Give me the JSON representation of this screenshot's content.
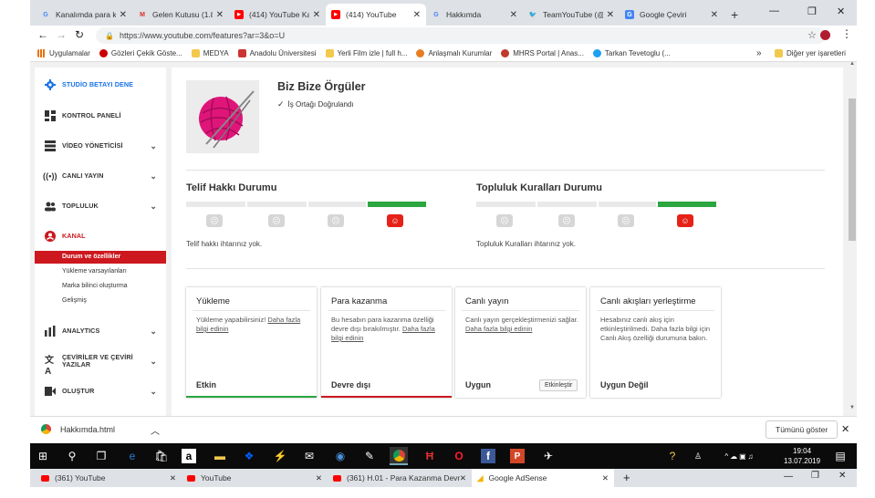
{
  "browser": {
    "tabs": [
      {
        "label": "Kanalımda para ka",
        "icon": "google-icon",
        "color": "#4285f4"
      },
      {
        "label": "Gelen Kutusu (1.8",
        "icon": "gmail-icon",
        "color": "#d93025"
      },
      {
        "label": "(414) YouTube Kar",
        "icon": "youtube-icon",
        "color": "#ff0000"
      },
      {
        "label": "(414) YouTube",
        "icon": "youtube-icon",
        "color": "#ff0000",
        "active": true
      },
      {
        "label": "Hakkımda",
        "icon": "google-icon",
        "color": "#4285f4"
      },
      {
        "label": "TeamYouTube (@T",
        "icon": "twitter-icon",
        "color": "#1da1f2"
      },
      {
        "label": "Google Çeviri",
        "icon": "translate-icon",
        "color": "#4285f4"
      }
    ],
    "new_tab": "+",
    "url": "https://www.youtube.com/features?ar=3&o=U",
    "bookmarks": [
      {
        "label": "Uygulamalar",
        "color": "#e8710a"
      },
      {
        "label": "Gözleri Çekik Göste...",
        "color": "#c00"
      },
      {
        "label": "MEDYA",
        "color": "#f2c94c"
      },
      {
        "label": "Anadolu Üniversitesi",
        "color": "#c33"
      },
      {
        "label": "Yerli Film izle | full h...",
        "color": "#f2c94c"
      },
      {
        "label": "Anlaşmalı Kurumlar",
        "color": "#e67e22"
      },
      {
        "label": "MHRS Portal | Anas...",
        "color": "#c0392b"
      },
      {
        "label": "Tarkan Tevetoglu (...",
        "color": "#1da1f2"
      }
    ],
    "bookmarks_more": "»",
    "other_bookmarks": "Diğer yer işaretleri"
  },
  "sidebar": {
    "studio_beta": "STUDİO BETAYI DENE",
    "items": [
      {
        "label": "KONTROL PANELİ",
        "icon": "dashboard-icon"
      },
      {
        "label": "VİDEO YÖNETİCİSİ",
        "icon": "video-manager-icon"
      },
      {
        "label": "CANLI YAYIN",
        "icon": "live-icon"
      },
      {
        "label": "TOPLULUK",
        "icon": "community-icon"
      },
      {
        "label": "KANAL",
        "icon": "channel-icon"
      }
    ],
    "kanal_subitems": [
      "Durum ve özellikler",
      "Yükleme varsayılanları",
      "Marka bilinci oluşturma",
      "Gelişmiş"
    ],
    "bottom_items": [
      {
        "label": "ANALYTICS",
        "icon": "analytics-icon"
      },
      {
        "label": "ÇEVİRİLER VE ÇEVİRİ YAZILAR",
        "icon": "translate-icon"
      },
      {
        "label": "OLUŞTUR",
        "icon": "create-icon"
      }
    ],
    "accent_color": "#cc181e"
  },
  "channel": {
    "name": "Biz Bize Örgüler",
    "verified": "İş Ortağı Doğrulandı"
  },
  "status": {
    "copyright": {
      "title": "Telif Hakkı Durumu",
      "message": "Telif hakkı ihtarınız yok."
    },
    "community": {
      "title": "Topluluk Kuralları Durumu",
      "message": "Topluluk Kuralları ihtarınız yok."
    }
  },
  "features": [
    {
      "title": "Yükleme",
      "desc": "Yükleme yapabilirsiniz! ",
      "link": "Daha fazla bilgi edinin",
      "desc_after": "",
      "status": "Etkin",
      "bar": "#2ba640"
    },
    {
      "title": "Para kazanma",
      "desc": "Bu hesabın para kazanma özelliği devre dışı bırakılmıştır. ",
      "link": "Daha fazla bilgi edinin",
      "desc_after": "",
      "status": "Devre dışı",
      "bar": "#cc181e"
    },
    {
      "title": "Canlı yayın",
      "desc": "Canlı yayın gerçekleştirmenizi sağlar. ",
      "link": "Daha fazla bilgi edinin",
      "desc_after": "",
      "status": "Uygun",
      "button": "Etkinleştir",
      "bar": ""
    },
    {
      "title": "Canlı akışları yerleştirme",
      "desc": "Hesabınız canlı akış için etkinleştirilmedi. Daha fazla bilgi için Canlı Akış özelliği durumuna bakın.",
      "link": "",
      "desc_after": "",
      "status": "Uygun Değil",
      "bar": ""
    }
  ],
  "download": {
    "file": "Hakkımda.html",
    "show_all": "Tümünü göster"
  },
  "taskbar": {
    "time": "19:04",
    "date": "13.07.2019"
  },
  "bottom_tabs": [
    {
      "label": "(361) YouTube"
    },
    {
      "label": "YouTube"
    },
    {
      "label": "(361) H.01 - Para Kazanma Devre"
    },
    {
      "label": "Google AdSense",
      "active": true
    }
  ]
}
